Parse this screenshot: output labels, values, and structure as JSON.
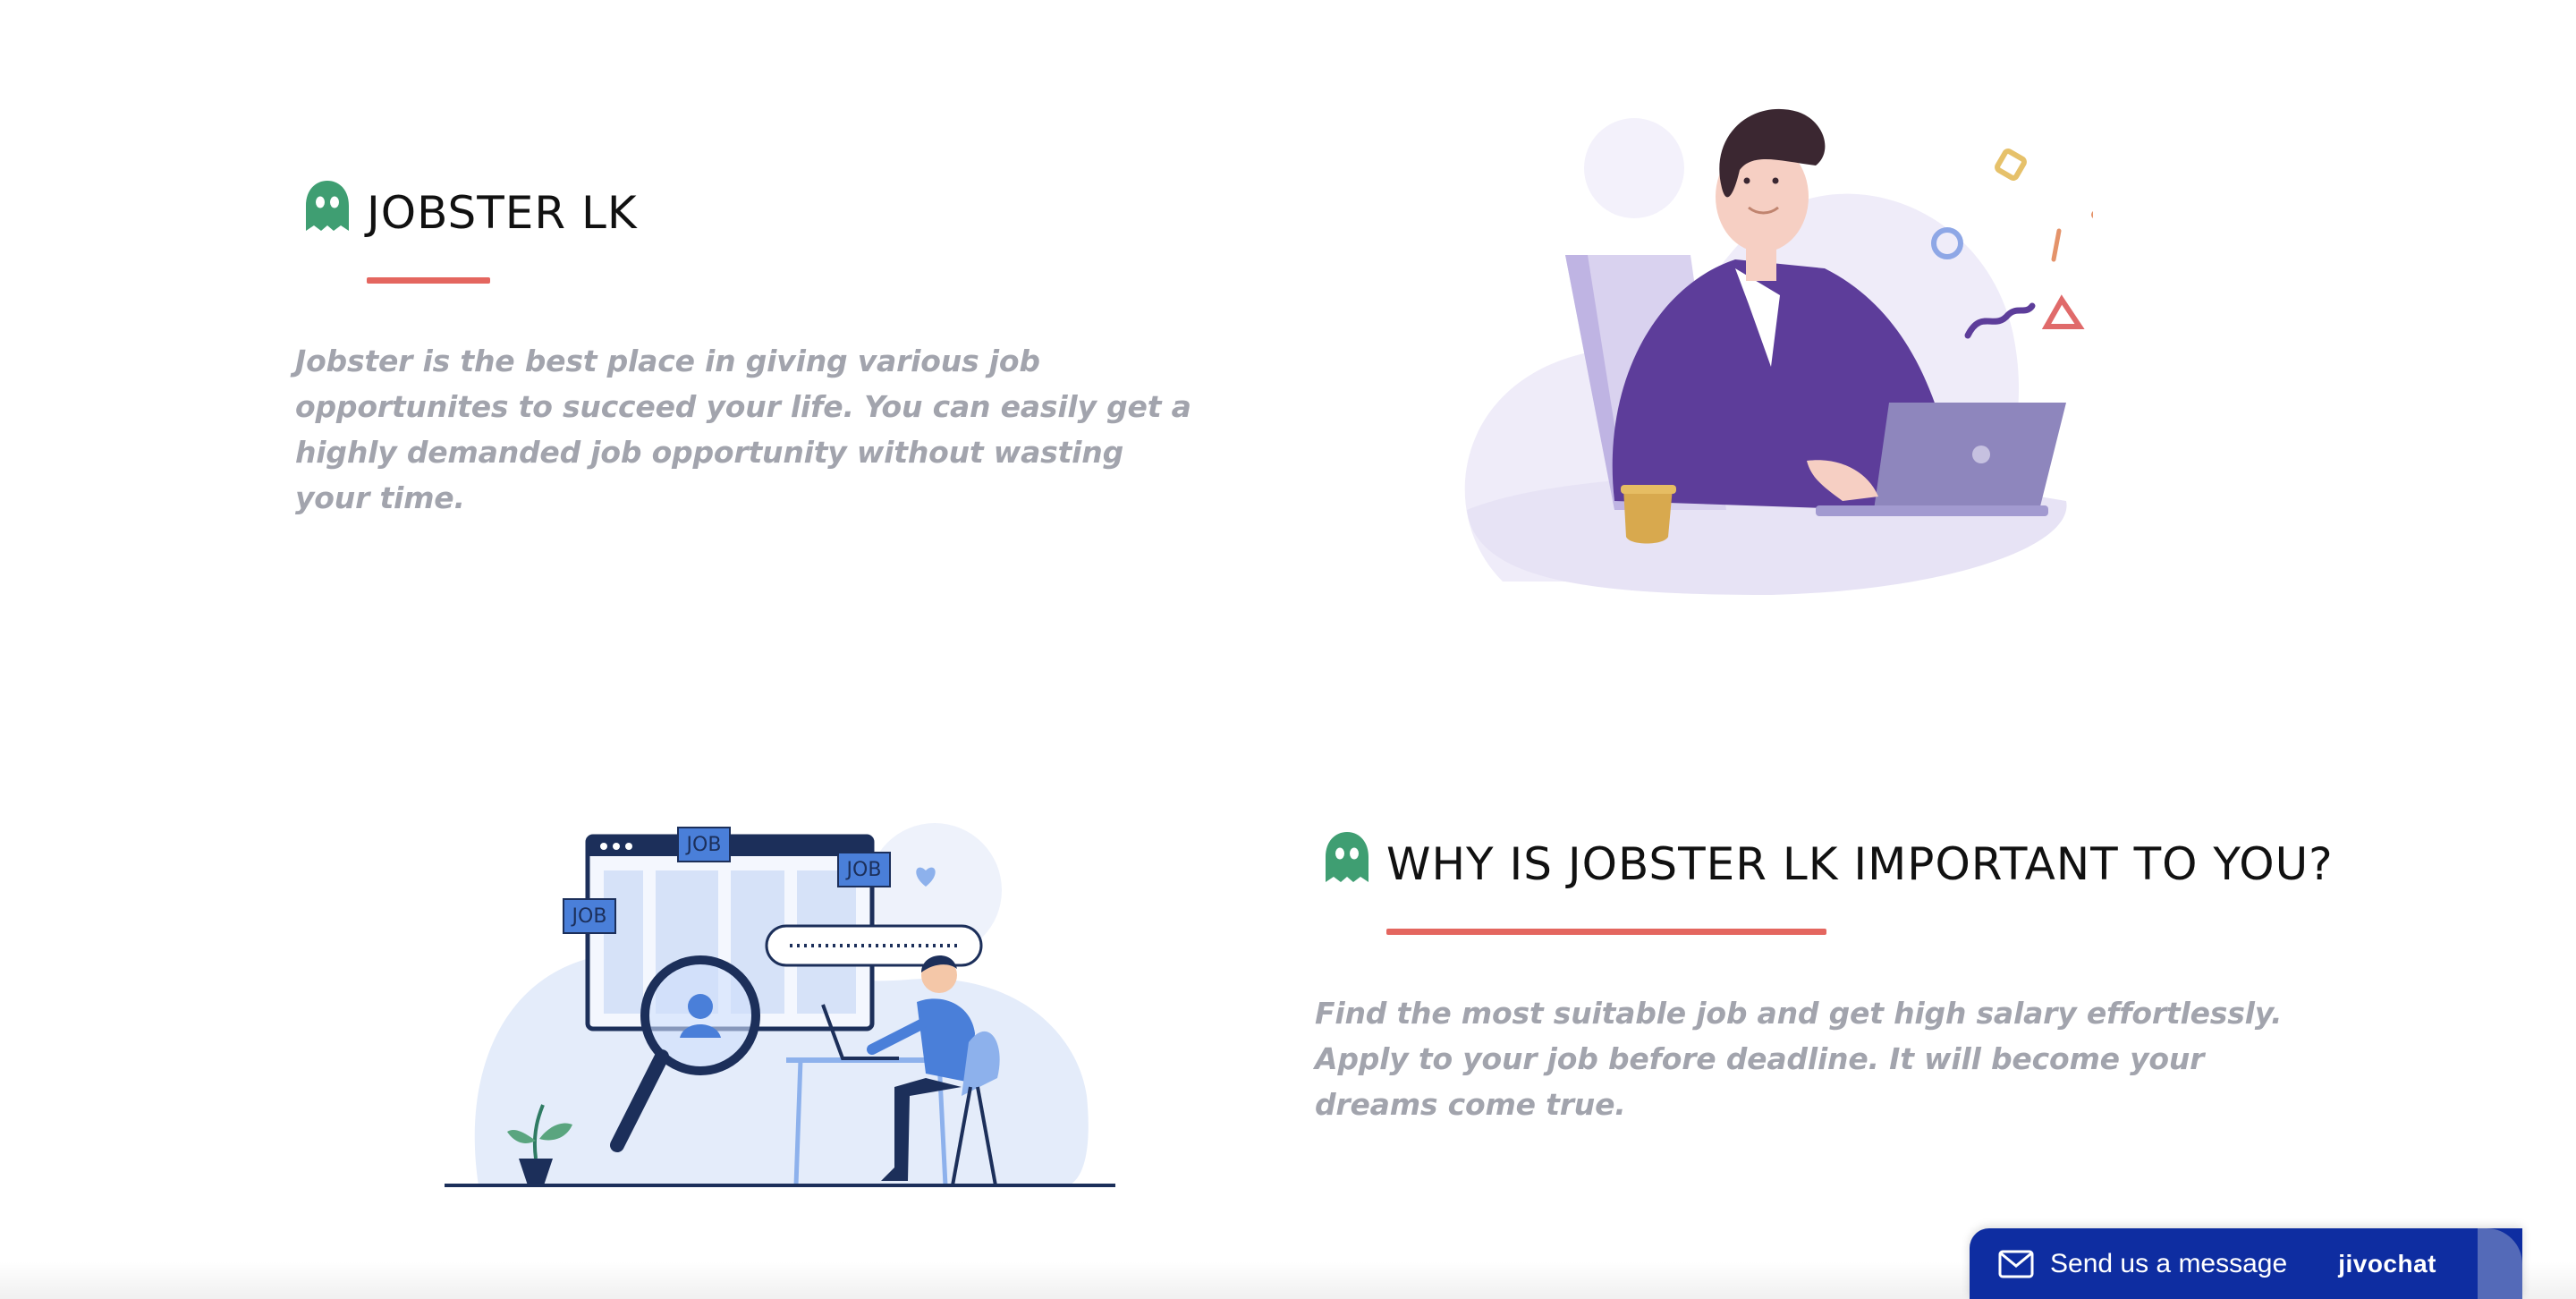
{
  "about": {
    "title": "JOBSTER LK",
    "description": "Jobster is the best place in giving various job opportunites to succeed your life. You can easily get a highly demanded job opportunity without wasting your time."
  },
  "why": {
    "title": "WHY IS JOBSTER LK IMPORTANT TO YOU?",
    "description": "Find the most suitable job and get high salary effortlessly. Apply to your job before deadline. It will become your dreams come true."
  },
  "illustration_tags": [
    "JOB",
    "JOB",
    "JOB"
  ],
  "chat_widget": {
    "message_label": "Send us a message",
    "brand": "jivochat"
  },
  "colors": {
    "accent": "#e4665f",
    "ghost": "#3f9e72",
    "chat_bar": "#0e2da1",
    "description_text": "#a2a4ad"
  }
}
